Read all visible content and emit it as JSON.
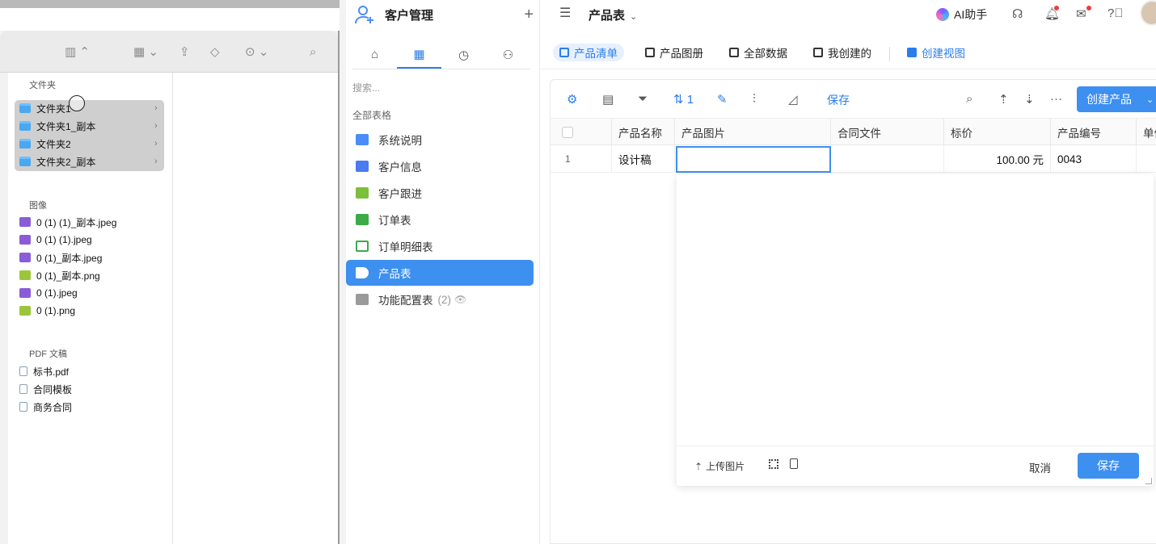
{
  "finder": {
    "sections": {
      "folders": "文件夹",
      "images": "图像",
      "pdf": "PDF 文稿"
    },
    "folders": [
      "文件夹1",
      "文件夹1_副本",
      "文件夹2",
      "文件夹2_副本"
    ],
    "images": [
      {
        "name": "0 (1) (1)_副本.jpeg",
        "kind": "jpeg"
      },
      {
        "name": "0 (1) (1).jpeg",
        "kind": "jpeg"
      },
      {
        "name": "0 (1)_副本.jpeg",
        "kind": "jpeg"
      },
      {
        "name": "0 (1)_副本.png",
        "kind": "png"
      },
      {
        "name": "0 (1).jpeg",
        "kind": "jpeg"
      },
      {
        "name": "0 (1).png",
        "kind": "png"
      }
    ],
    "pdfs": [
      "标书.pdf",
      "合同模板",
      "商务合同"
    ]
  },
  "sidebar": {
    "title": "客户管理",
    "search_placeholder": "搜索...",
    "section_label": "全部表格",
    "items": [
      {
        "label": "系统说明",
        "color": "#4a8df8",
        "active": false
      },
      {
        "label": "客户信息",
        "color": "#4a7bf0",
        "active": false
      },
      {
        "label": "客户跟进",
        "color": "#7cbf3a",
        "active": false
      },
      {
        "label": "订单表",
        "color": "#3bab4a",
        "active": false
      },
      {
        "label": "订单明细表",
        "color": "#3bab4a",
        "active": false
      },
      {
        "label": "产品表",
        "color": "#ffffff",
        "active": true
      },
      {
        "label": "功能配置表",
        "color": "#9a9a9a",
        "active": false,
        "count": "(2)"
      }
    ]
  },
  "main": {
    "breadcrumb": "产品表",
    "ai_label": "AI助手",
    "views": [
      "产品清单",
      "产品图册",
      "全部数据",
      "我创建的"
    ],
    "create_view": "创建视图",
    "toolbar": {
      "sort_count": "1",
      "save": "保存",
      "create_product": "创建产品"
    },
    "columns": [
      "产品名称",
      "产品图片",
      "合同文件",
      "标价",
      "产品编号",
      "单价"
    ],
    "rows": [
      {
        "index": "1",
        "name": "设计稿",
        "image": "",
        "contract": "",
        "price": "100.00 元",
        "code": "0043"
      }
    ],
    "popup": {
      "upload": "上传图片",
      "cancel": "取消",
      "save": "保存"
    }
  },
  "colors": {
    "accent": "#3d8ff0",
    "active_tab_bg": "#e6f0fe"
  }
}
